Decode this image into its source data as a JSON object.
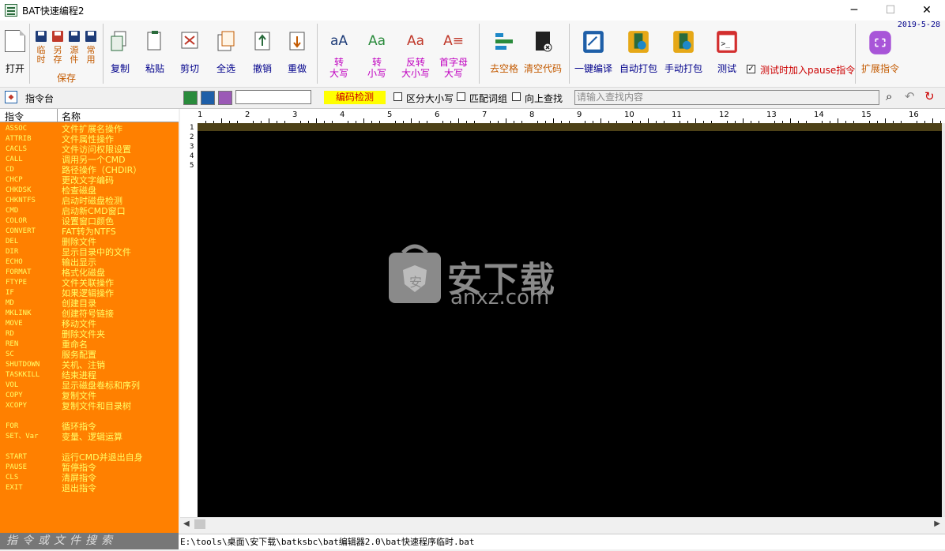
{
  "window": {
    "title": "BAT快速编程2",
    "minimize": "─",
    "maximize": "☐",
    "close": "✕",
    "date": "2019-5-28"
  },
  "toolbar": {
    "open": "打开",
    "save_group": {
      "items": [
        "临时",
        "另存",
        "源件",
        "常用"
      ],
      "label": "保存"
    },
    "copy": "复制",
    "paste": "粘贴",
    "cut": "剪切",
    "select_all": "全选",
    "undo": "撤销",
    "redo": "重做",
    "to_upper": "转\n大写",
    "to_lower": "转\n小写",
    "invert_case": "反转\n大小写",
    "capitalize": "首字母\n大写",
    "remove_spaces": "去空格",
    "clear_code": "清空代码",
    "compile": "一键编译",
    "auto_pack": "自动打包",
    "manual_pack": "手动打包",
    "test": "测试",
    "add_pause": "测试时加入pause指令",
    "expand": "扩展指令"
  },
  "colors": {
    "accent_orange": "#ff8000",
    "command_text": "#ffff66",
    "editor_bg": "#000000",
    "encode_bg": "#ffff00"
  },
  "panel": {
    "title": "指令台",
    "col_cmd": "指令",
    "col_name": "名称",
    "commands": [
      {
        "k": "ASSOC",
        "v": "文件扩展名操作"
      },
      {
        "k": "ATTRIB",
        "v": "文件属性操作"
      },
      {
        "k": "CACLS",
        "v": "文件访问权限设置"
      },
      {
        "k": "CALL",
        "v": "调用另一个CMD"
      },
      {
        "k": "CD",
        "v": "路径操作（CHDIR）"
      },
      {
        "k": "CHCP",
        "v": "更改文字编码"
      },
      {
        "k": "CHKDSK",
        "v": "检查磁盘"
      },
      {
        "k": "CHKNTFS",
        "v": "启动时磁盘检测"
      },
      {
        "k": "CMD",
        "v": "启动新CMD窗口"
      },
      {
        "k": "COLOR",
        "v": "设置窗口颜色"
      },
      {
        "k": "CONVERT",
        "v": "FAT转为NTFS"
      },
      {
        "k": "DEL",
        "v": "删除文件"
      },
      {
        "k": "DIR",
        "v": "显示目录中的文件"
      },
      {
        "k": "ECHO",
        "v": "输出显示"
      },
      {
        "k": "FORMAT",
        "v": "格式化磁盘"
      },
      {
        "k": "FTYPE",
        "v": "文件关联操作"
      },
      {
        "k": "IF",
        "v": "如果逻辑操作"
      },
      {
        "k": "MD",
        "v": "创建目录"
      },
      {
        "k": "MKLINK",
        "v": "创建符号链接"
      },
      {
        "k": "MOVE",
        "v": "移动文件"
      },
      {
        "k": "RD",
        "v": "删除文件夹"
      },
      {
        "k": "REN",
        "v": "重命名"
      },
      {
        "k": "SC",
        "v": "服务配置"
      },
      {
        "k": "SHUTDOWN",
        "v": "关机、注销"
      },
      {
        "k": "TASKKILL",
        "v": "结束进程"
      },
      {
        "k": "VOL",
        "v": "显示磁盘卷标和序列"
      },
      {
        "k": "COPY",
        "v": "复制文件"
      },
      {
        "k": "XCOPY",
        "v": "复制文件和目录树"
      }
    ],
    "commands2": [
      {
        "k": "FOR",
        "v": "循环指令"
      },
      {
        "k": "SET、Var",
        "v": "变量、逻辑运算"
      }
    ],
    "commands3": [
      {
        "k": "START",
        "v": "运行CMD并退出自身"
      },
      {
        "k": "PAUSE",
        "v": "暂停指令"
      },
      {
        "k": "CLS",
        "v": "清屏指令"
      },
      {
        "k": "EXIT",
        "v": "退出指令"
      }
    ],
    "search_placeholder": "指令或文件搜索"
  },
  "search": {
    "encode_detect": "编码检测",
    "case_sensitive": "区分大小写",
    "match_word": "匹配词组",
    "search_up": "向上查找",
    "find_placeholder": "请输入查找内容"
  },
  "editor": {
    "ruler": [
      "1",
      "2",
      "3",
      "4",
      "5",
      "6",
      "7",
      "8",
      "9",
      "10",
      "11",
      "12",
      "13",
      "14",
      "15",
      "16"
    ],
    "lines": [
      "1",
      "2",
      "3",
      "4",
      "5"
    ],
    "path": "E:\\tools\\桌面\\安下载\\batksbc\\bat编辑器2.0\\bat快速程序临时.bat"
  },
  "watermark": {
    "cn": "安下载",
    "en": "anxz.com",
    "badge": "安"
  }
}
